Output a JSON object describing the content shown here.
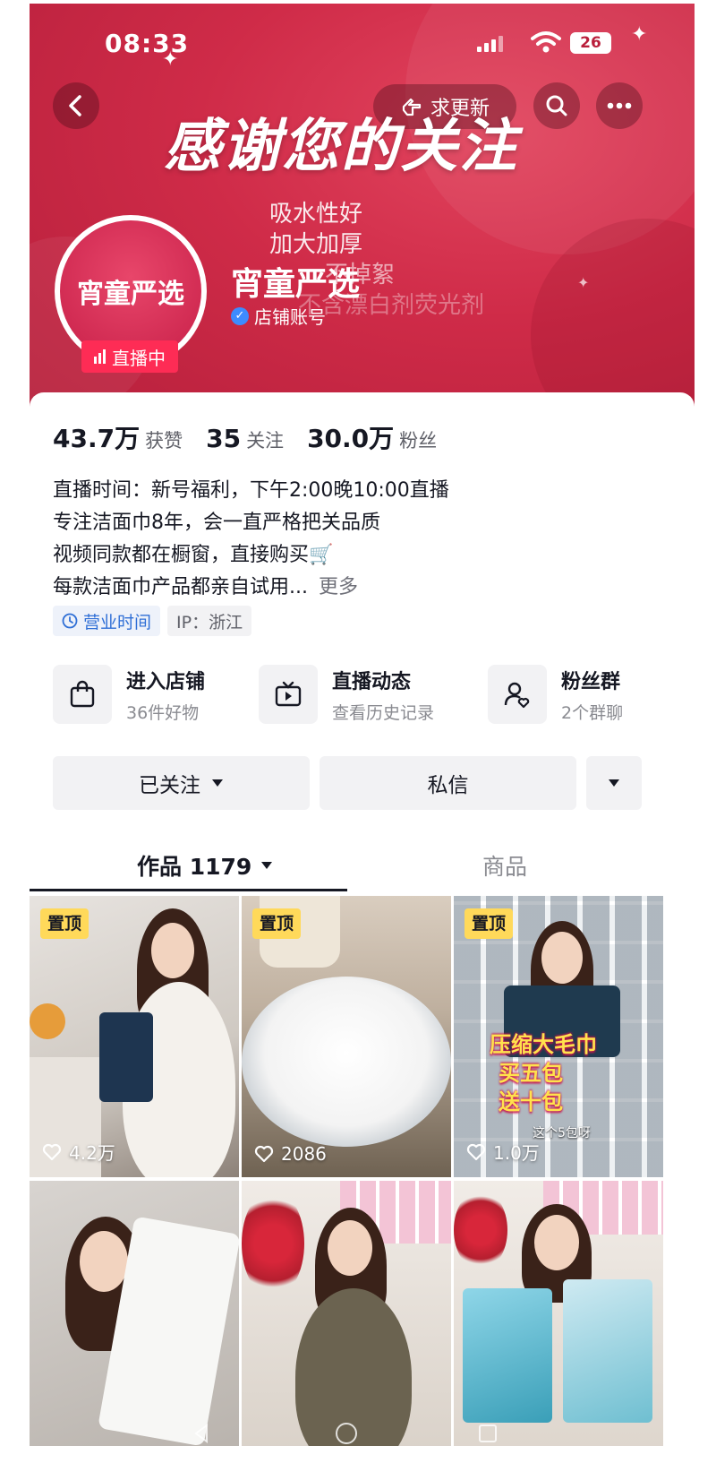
{
  "status_bar": {
    "time": "08:33",
    "battery": "26"
  },
  "header": {
    "refresh_button": "求更新",
    "banner_headline": "感谢您的关注",
    "banner_features": [
      "吸水性好",
      "加大加厚",
      "不掉絮",
      "不含漂白剂荧光剂"
    ]
  },
  "profile": {
    "avatar_text": "宵童严选",
    "live_badge": "直播中",
    "name": "宵童严选",
    "account_type": "店铺账号"
  },
  "stats": [
    {
      "value": "43.7万",
      "label": "获赞"
    },
    {
      "value": "35",
      "label": "关注"
    },
    {
      "value": "30.0万",
      "label": "粉丝"
    }
  ],
  "bio": {
    "lines": [
      "直播时间：新号福利，下午2:00晚10:00直播",
      "专注洁面巾8年，会一直严格把关品质",
      "视频同款都在橱窗，直接购买🛒",
      "每款洁面巾产品都亲自试用..."
    ],
    "more": "更多"
  },
  "tags": {
    "hours": "营业时间",
    "ip": "IP：浙江"
  },
  "quick_actions": [
    {
      "title": "进入店铺",
      "subtitle": "36件好物"
    },
    {
      "title": "直播动态",
      "subtitle": "查看历史记录"
    },
    {
      "title": "粉丝群",
      "subtitle": "2个群聊"
    }
  ],
  "buttons": {
    "followed": "已关注",
    "message": "私信"
  },
  "tabs": {
    "works": "作品 1179",
    "products": "商品"
  },
  "videos": [
    {
      "pinned": "置顶",
      "likes": "4.2万"
    },
    {
      "pinned": "置顶",
      "likes": "2086"
    },
    {
      "pinned": "置顶",
      "likes": "1.0万",
      "overlay": [
        "压缩大毛巾",
        "买五包",
        "送十包"
      ],
      "caption": "这个5包呀"
    },
    {},
    {},
    {}
  ],
  "colors": {
    "brand_red": "#cf2b48",
    "live_pink": "#fe2c55",
    "pin_yellow": "#ffd95a"
  }
}
